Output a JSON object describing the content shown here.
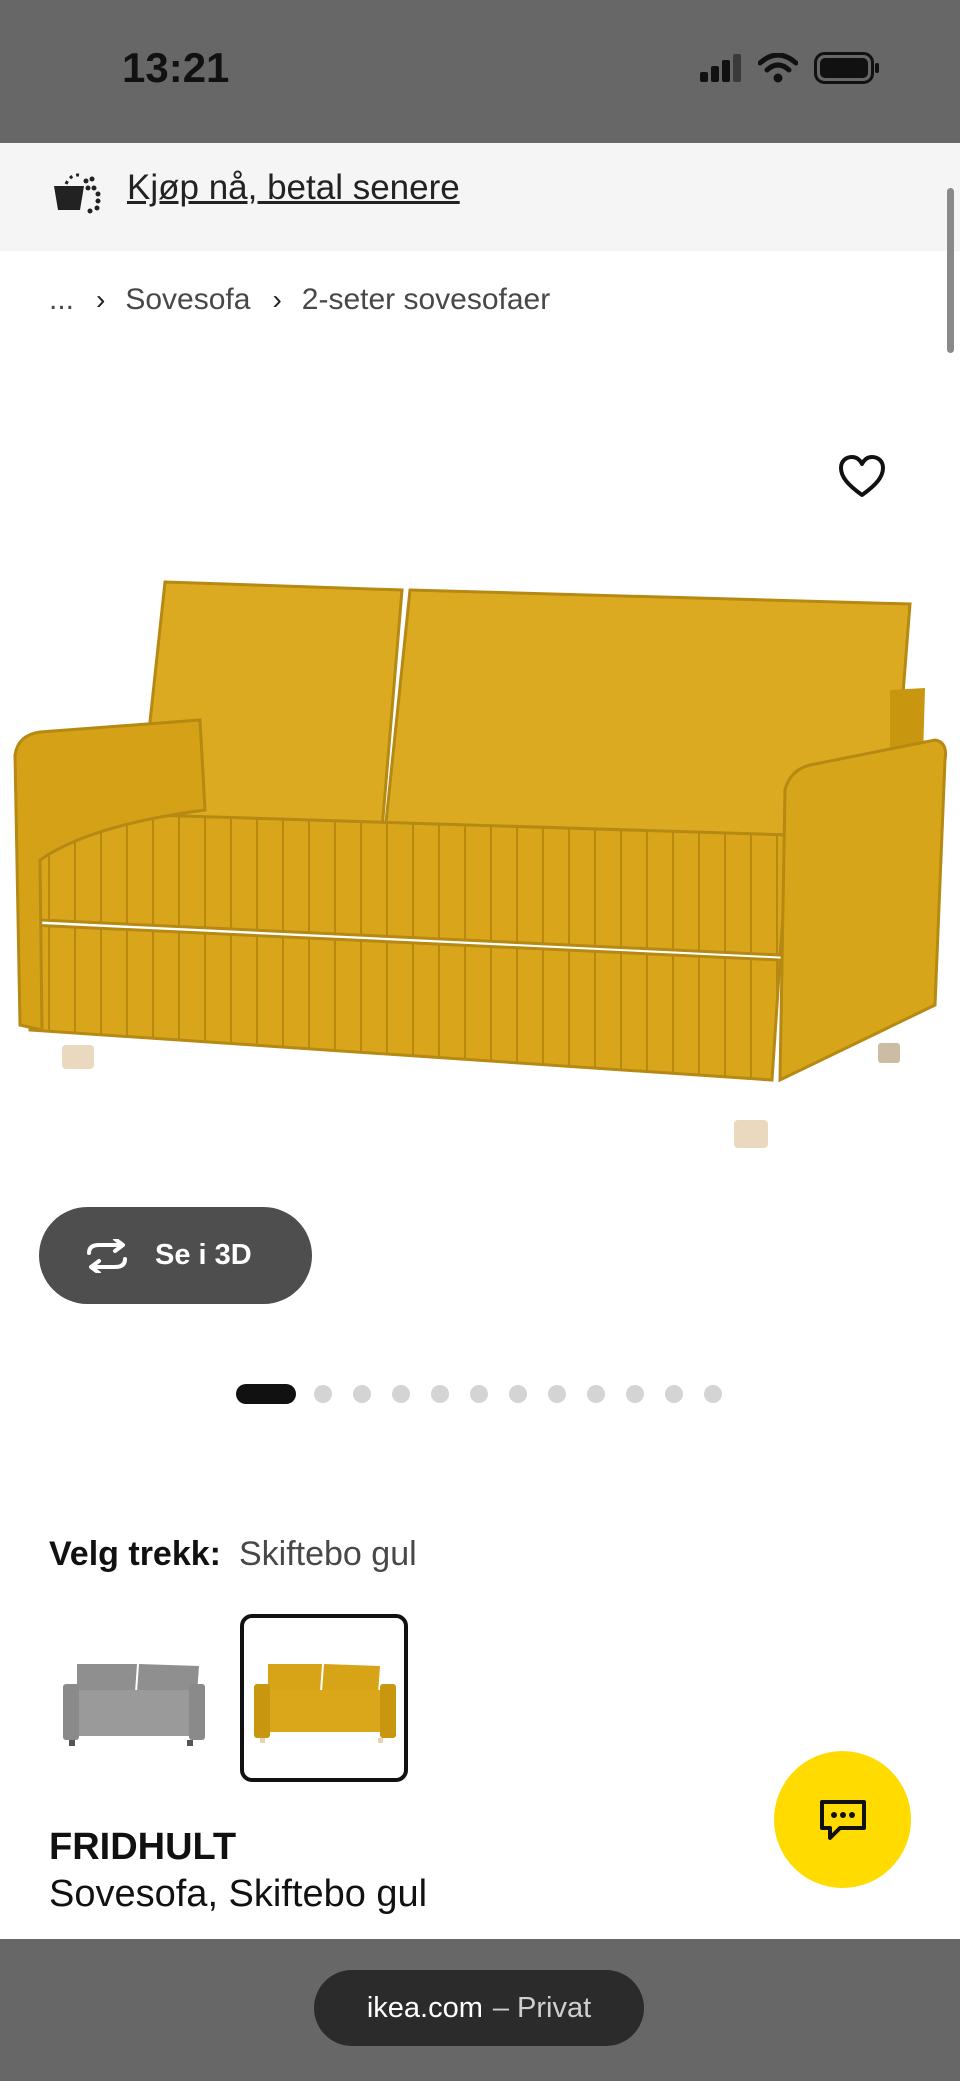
{
  "status_bar": {
    "time": "13:21",
    "icons": [
      "cellular-signal-icon",
      "wifi-icon",
      "battery-icon"
    ]
  },
  "bnpl_banner": {
    "icon": "basket-icon",
    "link_text": "Kjøp nå, betal senere"
  },
  "breadcrumb": {
    "items": [
      "...",
      "Sovesofa",
      "2-seter sovesofaer"
    ],
    "separator": "›"
  },
  "product_image": {
    "favorite_icon": "heart-icon",
    "view_3d_label": "Se i 3D",
    "view_3d_icon": "rotate-icon",
    "carousel": {
      "total": 12,
      "active_index": 0
    }
  },
  "cover_selector": {
    "label": "Velg trekk:",
    "selected_value": "Skiftebo gul",
    "options": [
      {
        "color": "#9a9a9a",
        "selected": false
      },
      {
        "color": "#dba71a",
        "selected": true
      }
    ]
  },
  "product": {
    "name": "FRIDHULT",
    "description": "Sovesofa, Skiftebo gul"
  },
  "chat_button": {
    "icon": "chat-icon",
    "color": "#ffdb00"
  },
  "browser_bar": {
    "domain": "ikea.com",
    "mode": "– Privat"
  },
  "colors": {
    "sofa_yellow": "#dba71a",
    "chrome_gray": "#676767",
    "ikea_yellow": "#ffdb00"
  }
}
